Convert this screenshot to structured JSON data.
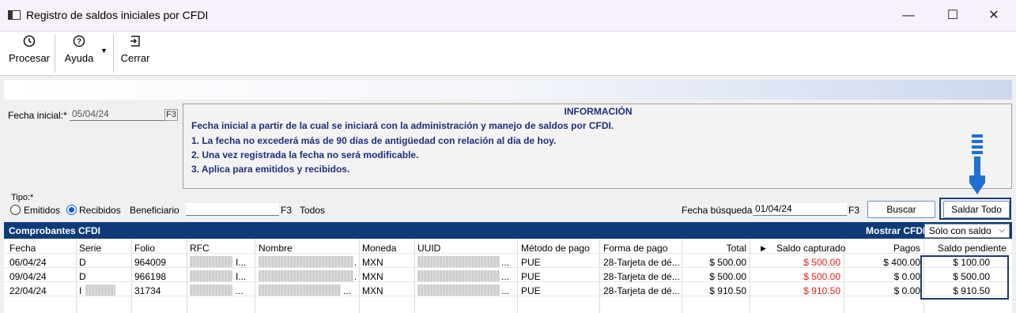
{
  "window": {
    "title": "Registro de saldos iniciales por CFDI",
    "controls": {
      "minimize": "—",
      "maximize": "☐",
      "close": "✕"
    }
  },
  "toolbar": {
    "procesar": "Procesar",
    "ayuda": "Ayuda",
    "cerrar": "Cerrar",
    "procesar_icon": "clock-icon",
    "ayuda_icon": "help-icon",
    "cerrar_icon": "exit-icon"
  },
  "fecha_inicial": {
    "label": "Fecha inicial:*",
    "value": "05/04/24",
    "f3": "F3"
  },
  "info": {
    "title": "INFORMACIÓN",
    "lines": [
      "Fecha inicial a partir de la cual se iniciará con la administración y manejo de saldos por CFDI.",
      "1. La fecha no excederá más de 90 días de antigüedad con relación al día de hoy.",
      "2. Una vez registrada la fecha no será modificable.",
      "3. Aplica para emitidos y recibidos."
    ]
  },
  "filters": {
    "tipo_label": "Tipo:*",
    "emitidos": "Emitidos",
    "recibidos": "Recibidos",
    "selected": "recibidos",
    "beneficiario_label": "Beneficiario",
    "beneficiario_value": "",
    "beneficiario_f3": "F3",
    "todos": "Todos",
    "fecha_busqueda_label": "Fecha búsqueda",
    "fecha_busqueda_value": "01/04/24",
    "fecha_busqueda_f3": "F3",
    "buscar": "Buscar",
    "saldar_todo": "Saldar Todo"
  },
  "grid": {
    "title": "Comprobantes CFDI",
    "mostrar_label": "Mostrar CFDI",
    "mostrar_value": "Sólo con saldo",
    "columns": [
      "Fecha",
      "Serie",
      "Folio",
      "RFC",
      "Nombre",
      "Moneda",
      "UUID",
      "Método de pago",
      "Forma de pago",
      "Total",
      "Saldo capturado",
      "Pagos",
      "Saldo pendiente"
    ],
    "rows": [
      {
        "fecha": "06/04/24",
        "serie": "D",
        "folio": "964009",
        "rfc": "I...",
        "nombre": ".",
        "moneda": "MXN",
        "uuid": "...",
        "metodo": "PUE",
        "forma": "28-Tarjeta de dé...",
        "total": "$ 500.00",
        "saldo_capturado": "$ 500.00",
        "pagos": "$ 400.00",
        "saldo_pendiente": "$ 100.00"
      },
      {
        "fecha": "09/04/24",
        "serie": "D",
        "folio": "966198",
        "rfc": "I...",
        "nombre": ".",
        "moneda": "MXN",
        "uuid": "...",
        "metodo": "PUE",
        "forma": "28-Tarjeta de dé...",
        "total": "$ 500.00",
        "saldo_capturado": "$ 500.00",
        "pagos": "$ 0.00",
        "saldo_pendiente": "$ 500.00"
      },
      {
        "fecha": "22/04/24",
        "serie": "I",
        "folio": "31734",
        "rfc": "...",
        "nombre": "...",
        "moneda": "MXN",
        "uuid": "...",
        "metodo": "PUE",
        "forma": "28-Tarjeta de dé...",
        "total": "$ 910.50",
        "saldo_capturado": "$ 910.50",
        "pagos": "$ 0.00",
        "saldo_pendiente": "$ 910.50"
      }
    ]
  },
  "colors": {
    "accent": "#0e3b78",
    "info_text": "#1e2f7c",
    "saldo_red": "#e02020",
    "arrow": "#1f6fd6"
  }
}
